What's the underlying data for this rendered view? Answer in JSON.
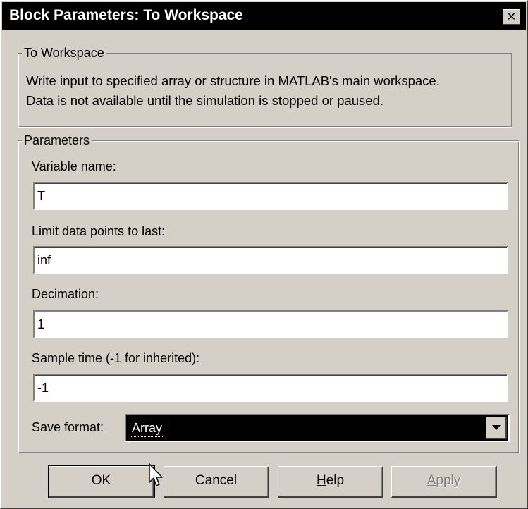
{
  "window": {
    "title": "Block Parameters: To Workspace",
    "close_glyph": "✕"
  },
  "description_group": {
    "legend": "To Workspace",
    "line1": "Write input to specified array or structure in MATLAB's main workspace.",
    "line2": "Data is not available until the simulation is stopped or paused."
  },
  "parameters": {
    "legend": "Parameters",
    "variable_name": {
      "label": "Variable name:",
      "value": "T"
    },
    "limit_points": {
      "label": "Limit data points to last:",
      "value": "inf"
    },
    "decimation": {
      "label": "Decimation:",
      "value": "1"
    },
    "sample_time": {
      "label": "Sample time (-1 for inherited):",
      "value": "-1"
    },
    "save_format": {
      "label": "Save format:",
      "selected": "Array",
      "arrow_icon": "chevron-down-icon"
    }
  },
  "buttons": {
    "ok": "OK",
    "cancel": "Cancel",
    "help_mnemonic": "H",
    "help_rest": "elp",
    "apply_mnemonic": "A",
    "apply_rest": "pply"
  },
  "cursor": {
    "icon": "mouse-pointer-icon"
  },
  "colors": {
    "face": "#d4d0c8",
    "titlebar": "#000000",
    "selection": "#000000",
    "disabled_text": "#808080"
  }
}
